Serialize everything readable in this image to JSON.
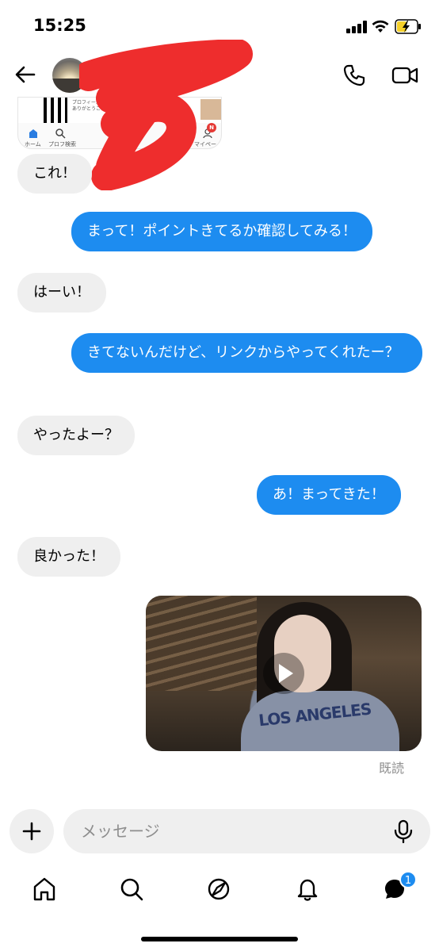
{
  "status_bar": {
    "time": "15:25"
  },
  "shared_screenshot": {
    "snippet_lines": [
      "プロフィール見てくれ",
      "ありがとうございます"
    ],
    "tabs": [
      "ホーム",
      "プロフ検索",
      "",
      "",
      "マイページ"
    ],
    "badge": "N"
  },
  "messages": [
    {
      "side": "in",
      "text": "これ！"
    },
    {
      "side": "out",
      "text": "まって！ポイントきてるか確認してみる！"
    },
    {
      "side": "in",
      "text": "はーい！"
    },
    {
      "side": "out",
      "text": "きてないんだけど、リンクからやってくれたー？"
    },
    {
      "side": "in",
      "text": "やったよー？"
    },
    {
      "side": "out",
      "text": "あ！まってきた！"
    },
    {
      "side": "in",
      "text": "良かった！"
    }
  ],
  "video_message": {
    "shirt_text": "LOS ANGELES"
  },
  "read_receipt": "既読",
  "composer": {
    "placeholder": "メッセージ"
  },
  "bottom_nav": {
    "items": [
      "home-icon",
      "search-icon",
      "explore-icon",
      "notifications-icon",
      "messages-icon"
    ],
    "messages_badge": "1"
  },
  "colors": {
    "outgoing_bubble": "#1d8cf0",
    "incoming_bubble": "#efefef",
    "badge": "#1d8cf0",
    "redaction": "#ee2d2d"
  }
}
